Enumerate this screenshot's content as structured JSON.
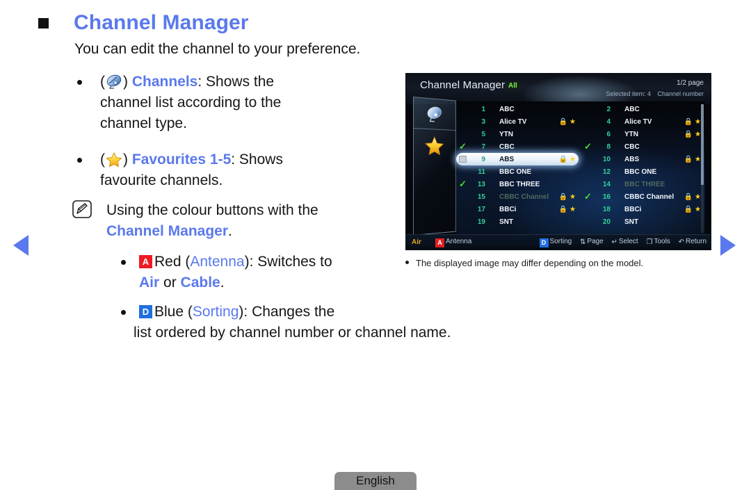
{
  "page": {
    "title": "Channel Manager",
    "subtitle": "You can edit the channel to your preference.",
    "language_button": "English"
  },
  "nav": {
    "prev_icon": "triangle-left-icon",
    "next_icon": "triangle-right-icon",
    "accent": "#5a79ec"
  },
  "bullets": [
    {
      "icon": "satellite-dish-icon",
      "open_paren": "(",
      "close_paren": ")",
      "term": "Channels",
      "colon": ":",
      "line1_rest": " Shows the",
      "line2": "channel list according to the",
      "line3": "channel type."
    },
    {
      "icon": "star-icon",
      "open_paren": "(",
      "close_paren": ")",
      "term": "Favourites 1",
      "term_sep": "-",
      "term2": "5",
      "colon": ":",
      "line1_rest": " Shows",
      "line2": "favourite channels."
    }
  ],
  "note": {
    "icon": "note-pencil-icon",
    "line1": "Using the colour buttons with the",
    "line2_link": "Channel Manager",
    "line2_period": ".",
    "items": [
      {
        "key": "A",
        "key_color": "#ee1b22",
        "pre": "Red (",
        "link": "Antenna",
        "post": "): Switches to",
        "line2_pre": "",
        "line2_link1": "Air",
        "line2_mid": " or ",
        "line2_link2": "Cable",
        "line2_post": "."
      },
      {
        "key": "D",
        "key_color": "#1f6fe0",
        "pre": "Blue (",
        "link": "Sorting",
        "post": "): Changes the",
        "line2_plain": "list ordered by channel number or channel name."
      }
    ]
  },
  "tv": {
    "title": "Channel Manager",
    "title_separator": "I",
    "filter": "All",
    "page_indicator": "1/2 page",
    "selected_item": "Selected item: 4",
    "sort_label": "Channel number",
    "panel": {
      "channels_icon": "satellite-dish-icon",
      "favourites_icon": "star-icon"
    },
    "scrollbar": "vertical-scrollbar",
    "columns": [
      {
        "name": "left-column",
        "rows": [
          {
            "check": "none",
            "number": "1",
            "label": "ABC",
            "lock": false,
            "fav": false,
            "dim": false,
            "selected": false
          },
          {
            "check": "none",
            "number": "3",
            "label": "Alice TV",
            "lock": true,
            "fav": true,
            "dim": false,
            "selected": false
          },
          {
            "check": "none",
            "number": "5",
            "label": "YTN",
            "lock": false,
            "fav": false,
            "dim": false,
            "selected": false
          },
          {
            "check": "tick",
            "number": "7",
            "label": "CBC",
            "lock": false,
            "fav": false,
            "dim": false,
            "selected": false
          },
          {
            "check": "box",
            "number": "9",
            "label": "ABS",
            "lock": true,
            "fav": true,
            "dim": false,
            "selected": true
          },
          {
            "check": "none",
            "number": "11",
            "label": "BBC ONE",
            "lock": false,
            "fav": false,
            "dim": false,
            "selected": false
          },
          {
            "check": "tick",
            "number": "13",
            "label": "BBC THREE",
            "lock": false,
            "fav": false,
            "dim": false,
            "selected": false
          },
          {
            "check": "none",
            "number": "15",
            "label": "CBBC Channel",
            "lock": true,
            "fav": true,
            "dim": true,
            "selected": false
          },
          {
            "check": "none",
            "number": "17",
            "label": "BBCi",
            "lock": true,
            "fav": true,
            "dim": false,
            "selected": false
          },
          {
            "check": "none",
            "number": "19",
            "label": "SNT",
            "lock": false,
            "fav": false,
            "dim": false,
            "selected": false
          }
        ]
      },
      {
        "name": "right-column",
        "rows": [
          {
            "check": "none",
            "number": "2",
            "label": "ABC",
            "lock": false,
            "fav": false,
            "dim": false,
            "selected": false
          },
          {
            "check": "none",
            "number": "4",
            "label": "Alice TV",
            "lock": true,
            "fav": true,
            "dim": false,
            "selected": false
          },
          {
            "check": "none",
            "number": "6",
            "label": "YTN",
            "lock": true,
            "fav": true,
            "dim": false,
            "selected": false
          },
          {
            "check": "tick",
            "number": "8",
            "label": "CBC",
            "lock": false,
            "fav": false,
            "dim": false,
            "selected": false
          },
          {
            "check": "none",
            "number": "10",
            "label": "ABS",
            "lock": true,
            "fav": true,
            "dim": false,
            "selected": false
          },
          {
            "check": "none",
            "number": "12",
            "label": "BBC ONE",
            "lock": false,
            "fav": false,
            "dim": false,
            "selected": false
          },
          {
            "check": "none",
            "number": "14",
            "label": "BBC THREE",
            "lock": false,
            "fav": false,
            "dim": true,
            "selected": false
          },
          {
            "check": "tick",
            "number": "16",
            "label": "CBBC Channel",
            "lock": true,
            "fav": true,
            "dim": false,
            "selected": false
          },
          {
            "check": "none",
            "number": "18",
            "label": "BBCi",
            "lock": true,
            "fav": true,
            "dim": false,
            "selected": false
          },
          {
            "check": "none",
            "number": "20",
            "label": "SNT",
            "lock": false,
            "fav": false,
            "dim": false,
            "selected": false
          }
        ]
      }
    ],
    "footer": {
      "air": "Air",
      "antenna_key": "A",
      "antenna_label": "Antenna",
      "sorting_key": "D",
      "sorting_label": "Sorting",
      "page_glyph": "⇅",
      "page_label": "Page",
      "select_glyph": "↵",
      "select_label": "Select",
      "tools_glyph": "❐",
      "tools_label": "Tools",
      "return_glyph": "↶",
      "return_label": "Return"
    }
  },
  "tv_caption": "The displayed image may differ depending on the model."
}
